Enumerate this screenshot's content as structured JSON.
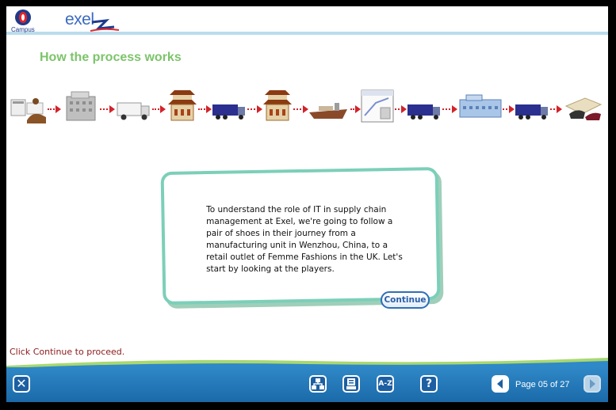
{
  "header": {
    "campus_label": "Campus",
    "brand": "exel"
  },
  "page": {
    "title": "How the process works"
  },
  "process_steps": [
    "designer-desk-icon",
    "factory-building-icon",
    "delivery-truck-icon",
    "chinese-office-icon",
    "lorry-icon",
    "chinese-warehouse-icon",
    "cargo-ship-icon",
    "distribution-map-icon",
    "lorry-icon",
    "warehouse-building-icon",
    "lorry-icon",
    "shoes-icon"
  ],
  "dialog": {
    "text": "To understand the role of IT in supply chain management at Exel, we're going to follow a pair of shoes in their journey from a manufacturing unit in Wenzhou, China, to a retail outlet of Femme Fashions in the UK. Let's start by looking at the players.",
    "continue_label": "Continue"
  },
  "footer": {
    "instruction": "Click Continue to proceed.",
    "glossary_label": "A-Z",
    "help_label": "?",
    "close_label": "✕",
    "page_indicator": "Page 05 of 27"
  },
  "colors": {
    "title": "#7cc46a",
    "toolbar": "#1b6aa9",
    "dialog_border": "#7ccfb9",
    "arrow": "#d2232a",
    "instruction": "#8b1a1a"
  }
}
